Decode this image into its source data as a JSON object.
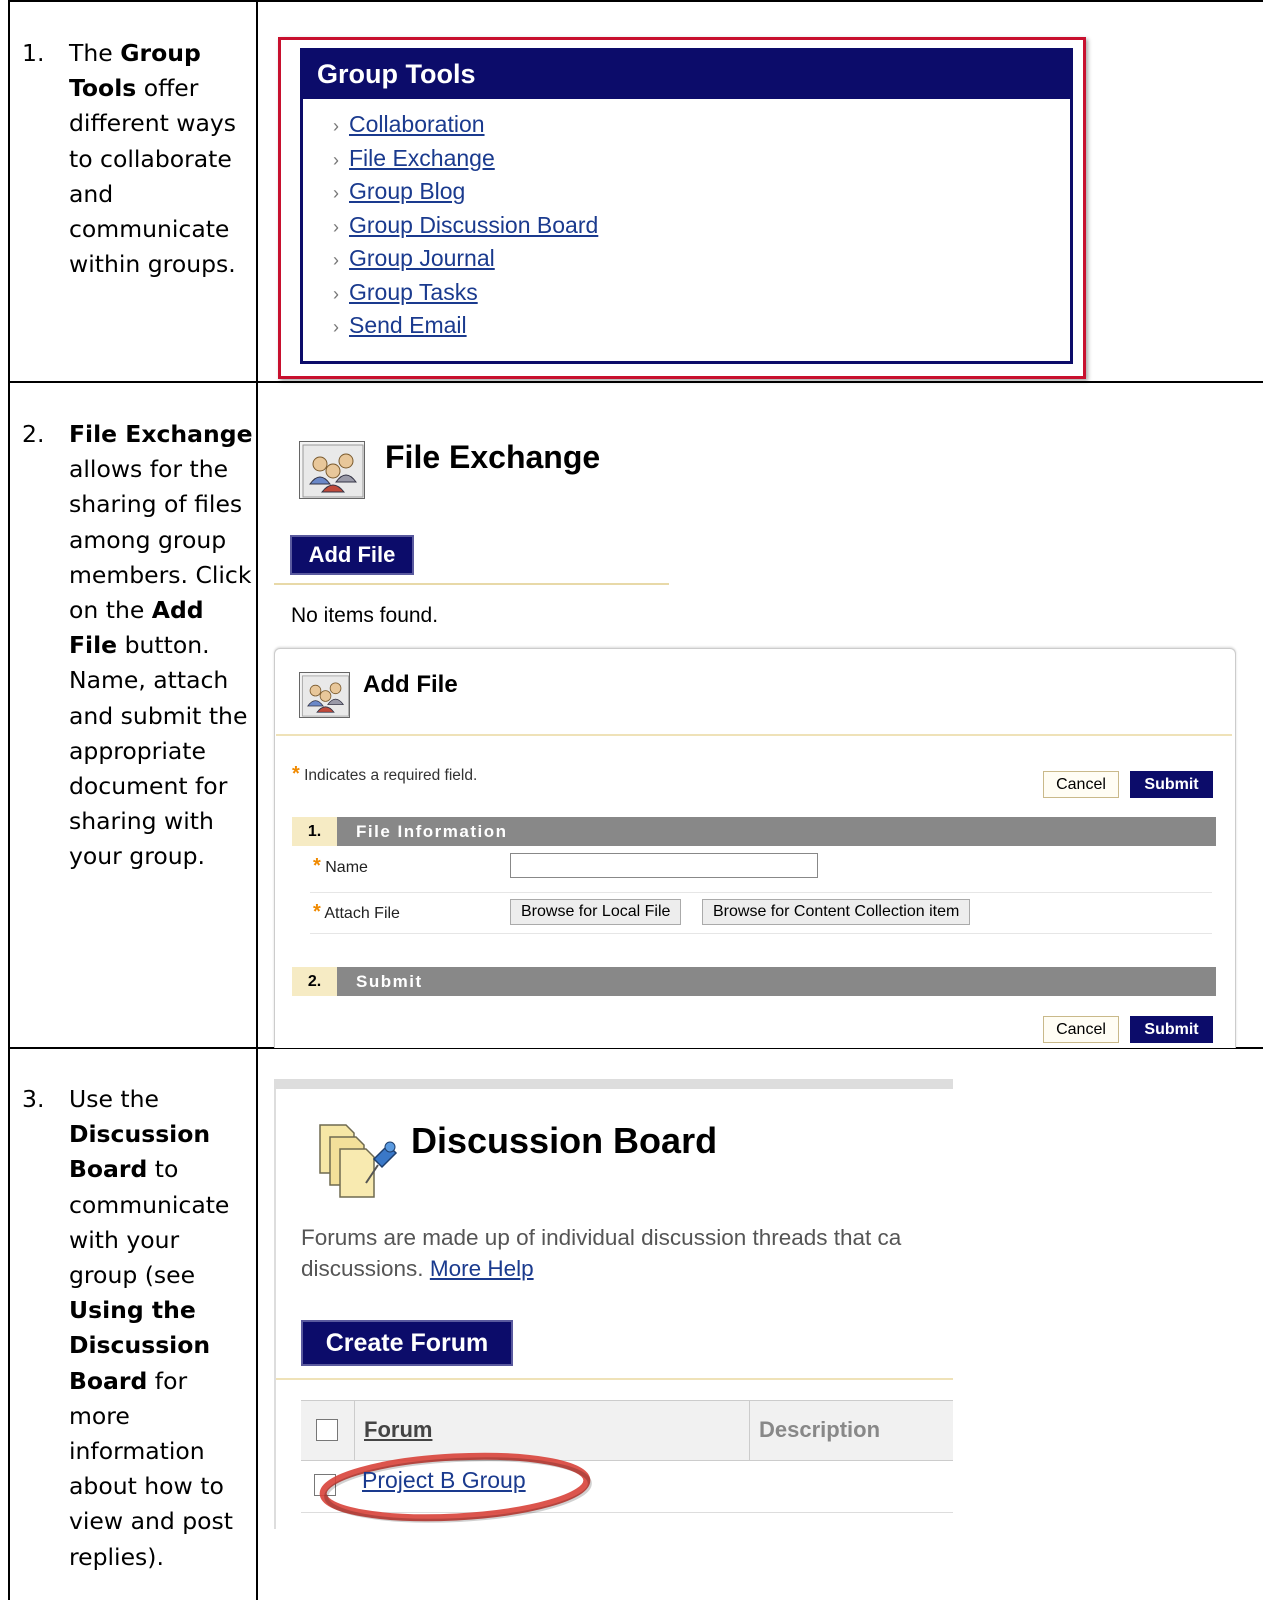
{
  "steps": [
    {
      "number": "1.",
      "parts": [
        {
          "t": "The "
        },
        {
          "t": "Group Tools",
          "b": true
        },
        {
          "t": " offer different ways to collaborate and communicate within groups."
        }
      ]
    },
    {
      "number": "2.",
      "parts": [
        {
          "t": "File Exchange",
          "b": true
        },
        {
          "t": " allows for the sharing of files among group members. Click on the "
        },
        {
          "t": "Add File",
          "b": true
        },
        {
          "t": " button. Name, attach and submit the appropriate document for sharing with your group."
        }
      ]
    },
    {
      "number": "3.",
      "parts": [
        {
          "t": "Use the "
        },
        {
          "t": "Discussion Board",
          "b": true
        },
        {
          "t": " to communicate with your group (see "
        },
        {
          "t": "Using the Discussion Board",
          "b": true
        },
        {
          "t": " for more information about how to view and post replies)."
        }
      ]
    }
  ],
  "group_tools": {
    "title": "Group Tools",
    "items": [
      "Collaboration",
      "File Exchange",
      "Group Blog",
      "Group Discussion Board",
      "Group Journal",
      "Group Tasks",
      "Send Email"
    ]
  },
  "file_exchange": {
    "title": "File Exchange",
    "add_button": "Add File",
    "empty_text": "No items found."
  },
  "add_file": {
    "title": "Add File",
    "required_note": "Indicates a required field.",
    "cancel_label": "Cancel",
    "submit_label": "Submit",
    "section1_number": "1.",
    "section1_label": "File Information",
    "name_label": "Name",
    "attach_label": "Attach File",
    "browse_local_label": "Browse for Local File",
    "browse_collection_label": "Browse for Content Collection item",
    "section2_number": "2.",
    "section2_label": "Submit"
  },
  "discussion_board": {
    "title": "Discussion Board",
    "description": "Forums are made up of individual discussion threads that ca",
    "description_line2": "discussions.",
    "help_link": "More Help",
    "create_button": "Create Forum",
    "column_forum": "Forum",
    "column_description": "Description",
    "row_forum": "Project B Group"
  },
  "colors": {
    "navy": "#0c0c6a",
    "highlight_red": "#c8102e",
    "link_blue": "#1a3a8e",
    "required_orange": "#f08a00"
  }
}
